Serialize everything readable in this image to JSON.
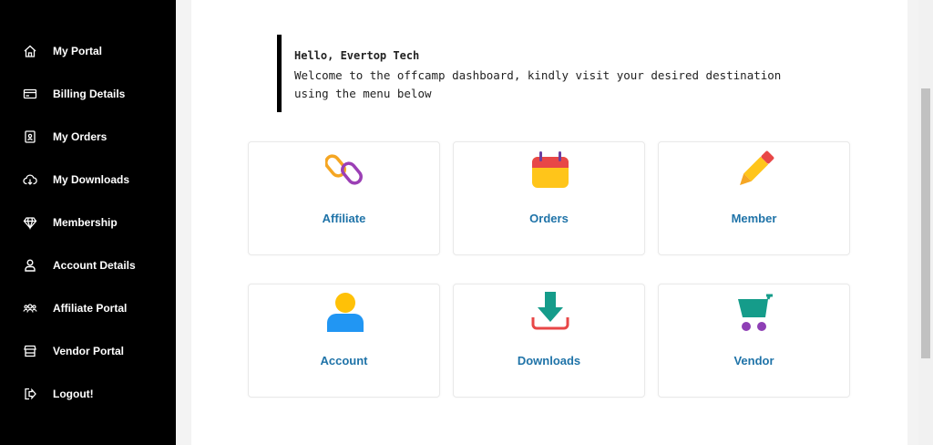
{
  "sidebar": {
    "items": [
      {
        "label": "My Portal",
        "icon": "home-icon"
      },
      {
        "label": "Billing Details",
        "icon": "credit-card-icon"
      },
      {
        "label": "My Orders",
        "icon": "orders-icon"
      },
      {
        "label": "My Downloads",
        "icon": "cloud-download-icon"
      },
      {
        "label": "Membership",
        "icon": "diamond-icon"
      },
      {
        "label": "Account Details",
        "icon": "user-icon"
      },
      {
        "label": "Affiliate Portal",
        "icon": "users-icon"
      },
      {
        "label": "Vendor Portal",
        "icon": "store-icon"
      },
      {
        "label": "Logout!",
        "icon": "logout-icon"
      }
    ]
  },
  "greeting": {
    "title": "Hello, Evertop Tech",
    "message": "Welcome to the offcamp dashboard, kindly visit your desired destination using the menu below"
  },
  "cards": [
    {
      "label": "Affiliate",
      "icon": "link-icon"
    },
    {
      "label": "Orders",
      "icon": "calendar-icon"
    },
    {
      "label": "Member",
      "icon": "pencil-icon"
    },
    {
      "label": "Account",
      "icon": "person-icon"
    },
    {
      "label": "Downloads",
      "icon": "download-icon"
    },
    {
      "label": "Vendor",
      "icon": "cart-icon"
    }
  ],
  "colors": {
    "sidebar_bg": "#000000",
    "card_label": "#1f73a8",
    "page_bg": "#f3f3f3"
  }
}
